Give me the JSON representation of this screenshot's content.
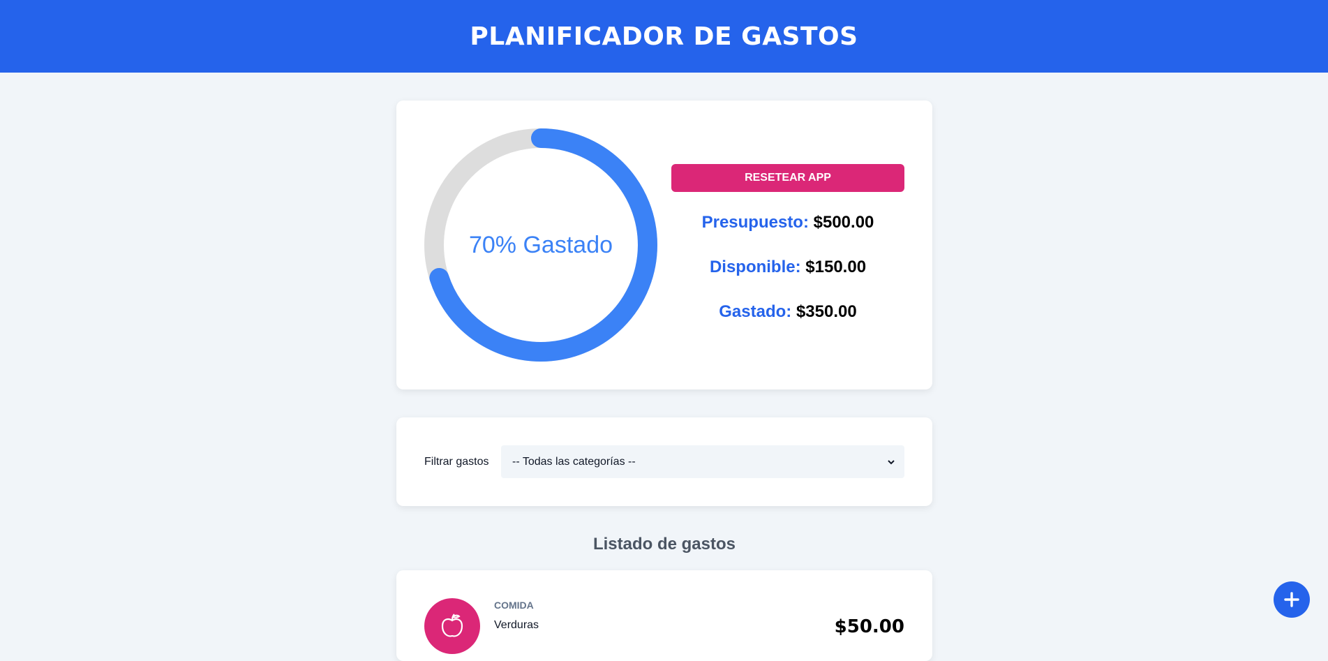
{
  "header": {
    "title": "PLANIFICADOR DE GASTOS"
  },
  "colors": {
    "primary": "#2563eb",
    "accent": "#db2777",
    "ring_fill": "#3b82f6",
    "ring_track": "#dddddd"
  },
  "budget": {
    "percent_spent": 70,
    "ring_label": "70% Gastado",
    "reset_label": "RESETEAR APP",
    "presupuesto_label": "Presupuesto:",
    "presupuesto_value": "$500.00",
    "disponible_label": "Disponible:",
    "disponible_value": "$150.00",
    "gastado_label": "Gastado:",
    "gastado_value": "$350.00"
  },
  "filter": {
    "label": "Filtrar gastos",
    "selected": "-- Todas las categorías --"
  },
  "list": {
    "title": "Listado de gastos",
    "items": [
      {
        "category": "COMIDA",
        "name": "Verduras",
        "amount": "$50.00",
        "icon": "apple-icon"
      }
    ]
  },
  "fab": {
    "icon": "plus-icon"
  }
}
